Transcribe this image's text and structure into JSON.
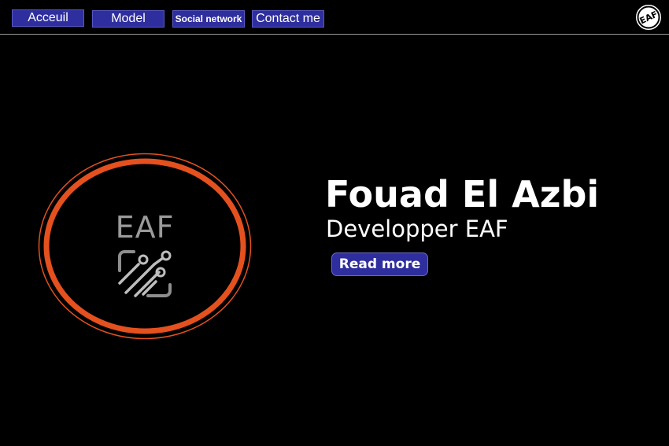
{
  "nav": {
    "items": [
      {
        "label": "Acceuil"
      },
      {
        "label": "Model"
      },
      {
        "label": "Social network"
      },
      {
        "label": "Contact me"
      }
    ]
  },
  "logo": {
    "text": "EAF",
    "accent_color": "#e4511f"
  },
  "hero": {
    "name": "Fouad El Azbi",
    "role": "Developper EAF",
    "cta_label": "Read more"
  },
  "colors": {
    "background": "#000000",
    "button": "#2e2e9e",
    "text": "#ffffff"
  }
}
